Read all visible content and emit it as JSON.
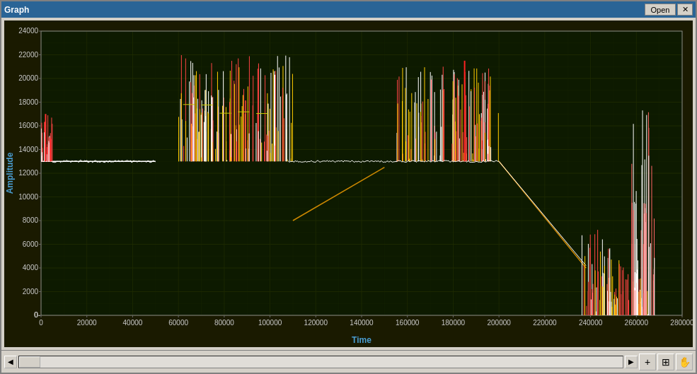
{
  "window": {
    "title": "Graph",
    "open_button": "Open",
    "close_button": "✕"
  },
  "chart": {
    "y_axis_label": "Amplitude",
    "x_axis_label": "Time",
    "y_min": 0,
    "y_max": 24000,
    "x_min": 0,
    "x_max": 280000,
    "y_ticks": [
      0,
      2000,
      4000,
      6000,
      8000,
      10000,
      12000,
      14000,
      16000,
      18000,
      20000,
      22000,
      24000
    ],
    "x_ticks": [
      0,
      20000,
      40000,
      60000,
      80000,
      100000,
      120000,
      140000,
      160000,
      180000,
      200000,
      220000,
      240000,
      260000,
      280000
    ],
    "bg_color": "#1a1a00",
    "grid_color": "#3a3a00",
    "grid_major_color": "#4a5a00"
  },
  "toolbar": {
    "zoom_in": "+",
    "zoom_fit": "⊞",
    "pan": "✋"
  }
}
